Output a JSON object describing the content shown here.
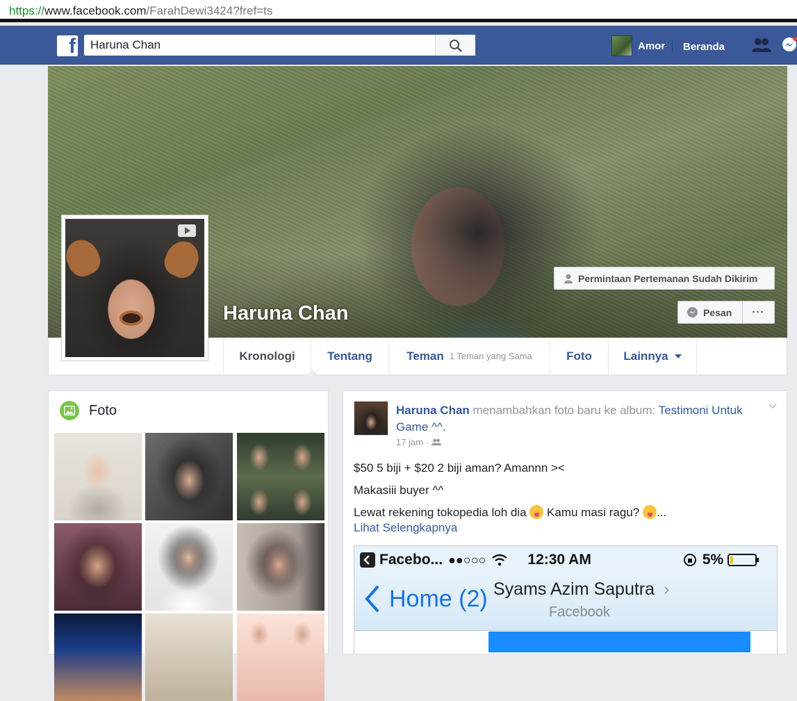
{
  "browser": {
    "url_protocol": "https://",
    "url_domain": "www.facebook.com",
    "url_path": "/FarahDewi3424?fref=ts"
  },
  "topbar": {
    "logo": "f",
    "search_value": "Haruna Chan",
    "user_name": "Amor",
    "home_label": "Beranda"
  },
  "profile": {
    "name": "Haruna Chan",
    "friend_request_label": "Permintaan Pertemanan Sudah Dikirim",
    "message_label": "Pesan",
    "more_label": "···"
  },
  "tabs": [
    {
      "label": "Kronologi",
      "active": true
    },
    {
      "label": "Tentang"
    },
    {
      "label": "Teman",
      "sub": "1 Teman yang Sama"
    },
    {
      "label": "Foto"
    },
    {
      "label": "Lainnya"
    }
  ],
  "photos": {
    "title": "Foto"
  },
  "post": {
    "author": "Haruna Chan",
    "action_text": " menambahkan foto baru ke album: ",
    "album": "Testimoni Untuk Game ^^.",
    "time": "17 jam",
    "line1": "$50 5 biji + $20 2 biji aman? Amannn ><",
    "line2": "Makasiii buyer ^^",
    "line3a": "Lewat rekening tokopedia loh dia ",
    "line3b": " Kamu masi ragu? ",
    "line3c": "...",
    "see_more": "Lihat Selengkapnya",
    "screenshot": {
      "carrier": "Facebo...",
      "signal": "●●○○○",
      "time": "12:30 AM",
      "battery": "5%",
      "back_label": "Home (2)",
      "title": "Syams Azim Saputra",
      "subtitle": "Facebook"
    }
  },
  "colors": {
    "fb_blue": "#3b5998",
    "link_blue": "#365899",
    "page_bg": "#e9ebee"
  }
}
